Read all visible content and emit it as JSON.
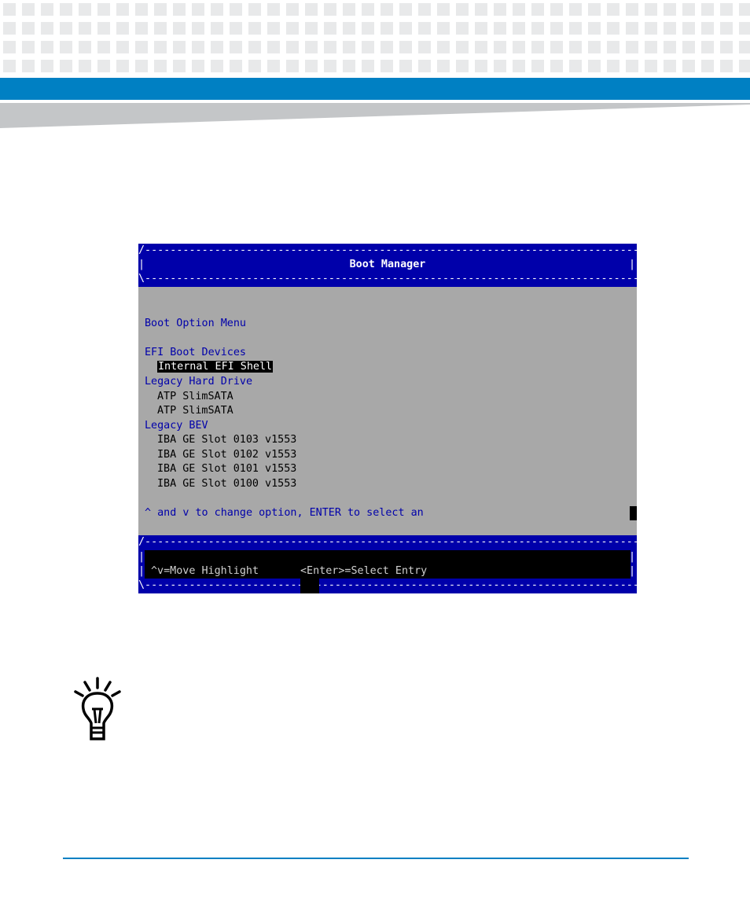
{
  "header": {
    "brand_band_color": "#0080c3",
    "wedge_color": "#c4c6c8"
  },
  "terminal": {
    "title": "Boot Manager",
    "border_top": "/-------------------------------------------------------------------------------\\",
    "border_bottom": "\\-------------------------------------------------------------------------------/",
    "menu_heading": "Boot Option Menu",
    "groups": [
      {
        "label": "EFI Boot Devices",
        "items": [
          "Internal EFI Shell"
        ]
      },
      {
        "label": "Legacy Hard Drive",
        "items": [
          "ATP SlimSATA",
          "ATP SlimSATA"
        ]
      },
      {
        "label": "Legacy BEV",
        "items": [
          "IBA GE Slot 0103 v1553",
          "IBA GE Slot 0102 v1553",
          "IBA GE Slot 0101 v1553",
          "IBA GE Slot 0100 v1553"
        ]
      }
    ],
    "selected_item": "Internal EFI Shell",
    "help_text": "^ and v to change option, ENTER to select an",
    "footer_move": "^v=Move Highlight",
    "footer_select": "<Enter>=Select Entry",
    "colors": {
      "header_bg": "#0000aa",
      "body_bg": "#a8a8a8",
      "label_fg": "#0000aa",
      "item_fg": "#000000"
    }
  },
  "icons": {
    "tip": "lightbulb-icon"
  }
}
